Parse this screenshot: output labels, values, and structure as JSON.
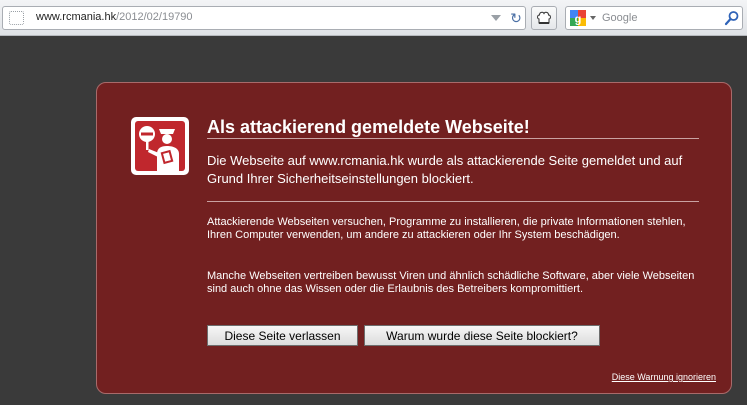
{
  "toolbar": {
    "url_host": "www.rcmania.hk",
    "url_path": "/2012/02/19790",
    "search_placeholder": "Google"
  },
  "icons": {
    "site": "page-icon",
    "url_dropdown": "chevron-down-icon",
    "reload": "reload-icon",
    "addon": "chef-hat-icon",
    "search_engine": "google-icon",
    "search": "magnifier-icon",
    "warning": "officer-stop-icon"
  },
  "colors": {
    "panel_background": "#722020",
    "badge_red": "#c0272d"
  },
  "warning": {
    "title": "Als attackierend gemeldete Webseite!",
    "lead": "Die Webseite auf www.rcmania.hk wurde als attackierende Seite gemeldet und auf Grund Ihrer Sicherheitseinstellungen blockiert.",
    "paragraph1": "Attackierende Webseiten versuchen, Programme zu installieren, die private Informationen stehlen, Ihren Computer verwenden, um andere zu attackieren oder Ihr System beschädigen.",
    "paragraph2": "Manche Webseiten vertreiben bewusst Viren und ähnlich schädliche Software, aber viele Webseiten sind auch ohne das Wissen oder die Erlaubnis des Betreibers kompromittiert.",
    "leave_button": "Diese Seite verlassen",
    "why_button": "Warum wurde diese Seite blockiert?",
    "ignore_link": "Diese Warnung ignorieren"
  }
}
